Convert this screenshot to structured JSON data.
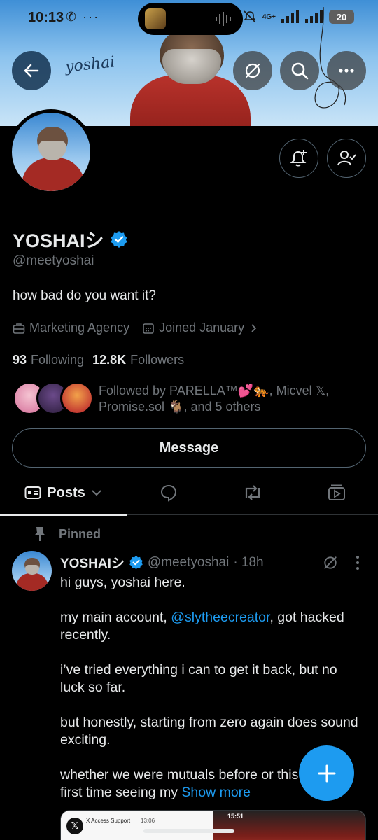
{
  "status_bar": {
    "time": "10:13",
    "left_icons": "✆ ···",
    "network": "4G+",
    "battery": "20"
  },
  "header": {
    "banner_signature": "yoshai",
    "back_icon": "arrow-left-icon",
    "grok_icon": "grok-icon",
    "search_icon": "search-icon",
    "more_icon": "more-horizontal-icon"
  },
  "profile": {
    "display_name": "YOSHAIシ",
    "verified": true,
    "handle": "@meetyoshai",
    "bio": "how bad do you want it?",
    "category": "Marketing Agency",
    "joined": "Joined January",
    "following_count": "93",
    "following_label": "Following",
    "followers_count": "12.8K",
    "followers_label": "Followers",
    "followed_by_text": "Followed by PARELLA™💕🐅, Micvel 𝕏, Promise.sol 🐐, and 5 others",
    "message_label": "Message"
  },
  "tabs": {
    "posts_label": "Posts"
  },
  "pinned_post": {
    "pinned_label": "Pinned",
    "author_name": "YOSHAIシ",
    "author_handle": "@meetyoshai",
    "time": "· 18h",
    "para1": "hi guys, yoshai here.",
    "para2_before": "my main account, ",
    "para2_mention": "@slytheecreator",
    "para2_after": ", got hacked recently.",
    "para3": "i’ve tried everything i can to get it back, but no luck so far.",
    "para4": "but honestly, starting from zero again does sound exciting.",
    "para5": "whether we were mutuals before or this is your first time seeing my ",
    "show_more": "Show more",
    "media_mail_from": "X Access Support",
    "media_mail_time": "13:06",
    "media_right_time": "15:51"
  },
  "colors": {
    "accent": "#1d9bf0",
    "text_primary": "#e7e9ea",
    "text_secondary": "#71767b",
    "border": "#2f3336"
  }
}
